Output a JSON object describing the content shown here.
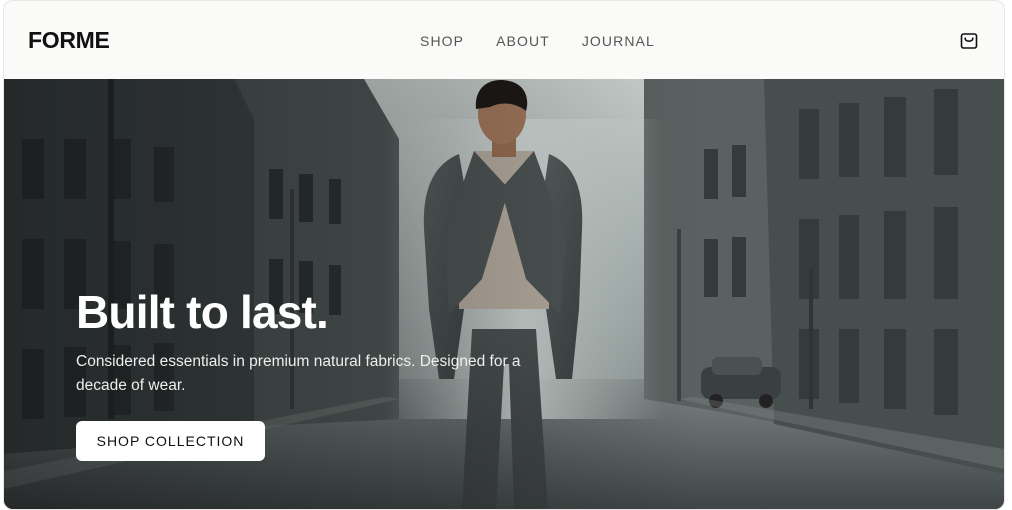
{
  "brand": {
    "name": "FORME"
  },
  "nav": {
    "items": [
      "SHOP",
      "ABOUT",
      "JOURNAL"
    ]
  },
  "header": {
    "cart_icon": "shopping-bag-icon"
  },
  "hero": {
    "title": "Built to last.",
    "subtitle": "Considered essentials in premium natural fabrics. Designed for a decade of wear.",
    "cta_label": "SHOP COLLECTION"
  }
}
